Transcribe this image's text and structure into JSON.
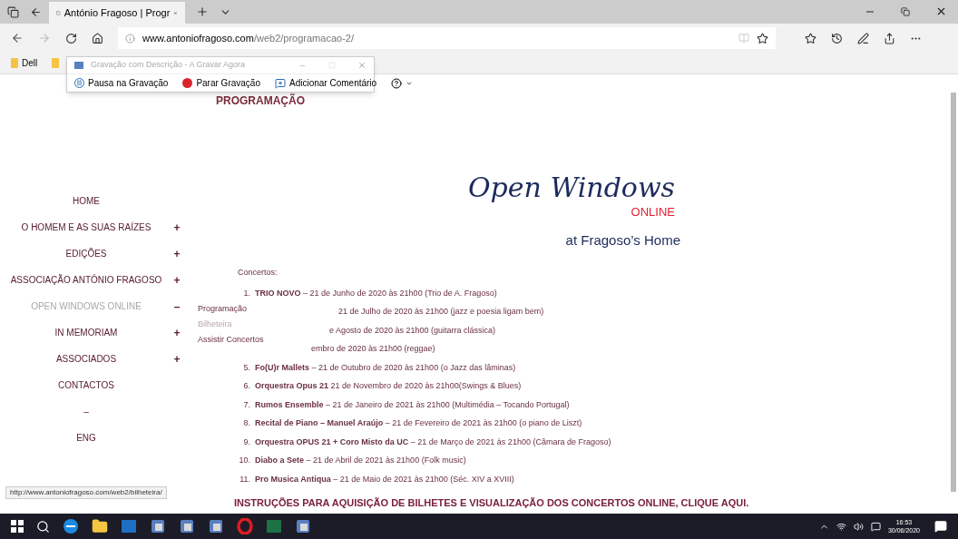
{
  "browser": {
    "tab_title": "António Fragoso | Progr",
    "url_host": "www.antoniofragoso.com",
    "url_path": "/web2/programacao-2/",
    "bookmarks": [
      "Dell"
    ]
  },
  "recorder": {
    "title": "Gravação com Descrição - A Gravar Agora",
    "buttons": [
      {
        "kind": "pause",
        "label": "Pausa na Gravação"
      },
      {
        "kind": "stop",
        "label": "Parar Gravação"
      },
      {
        "kind": "comment",
        "label": "Adicionar Comentário"
      },
      {
        "kind": "help"
      }
    ]
  },
  "page_heading": "PROGRAMAÇÃO",
  "nav": [
    {
      "label": "HOME",
      "selected": false
    },
    {
      "label": "O HOMEM E AS SUAS RAÍZES",
      "toggle": "+",
      "selected": false
    },
    {
      "label": "EDIÇÕES",
      "toggle": "+",
      "selected": false
    },
    {
      "label": "ASSOCIAÇÃO ANTÓNIO FRAGOSO",
      "toggle": "+",
      "selected": false
    },
    {
      "label": "OPEN WINDOWS ONLINE",
      "toggle": "–",
      "selected": true
    },
    {
      "label": "IN MEMORIAM",
      "toggle": "+",
      "selected": false
    },
    {
      "label": "ASSOCIADOS",
      "toggle": "+",
      "selected": false
    },
    {
      "label": "CONTACTOS",
      "selected": false
    },
    {
      "label": "–",
      "selected": false
    },
    {
      "label": "ENG",
      "selected": false
    }
  ],
  "submenu": [
    {
      "label": "Programação",
      "selected": false
    },
    {
      "label": "Bilheteira",
      "selected": true
    },
    {
      "label": "Assistir Concertos",
      "selected": false
    }
  ],
  "logo": {
    "title": "Open Windows",
    "subtitle": "ONLINE",
    "tagline": "at Fragoso’s Home"
  },
  "concerts_label": "Concertos:",
  "concerts": [
    {
      "number": "1.",
      "text": "**TRIO NOVO** – 21 de Junho de 2020 às 21h00 (Trio de A. Fragoso)"
    },
    {
      "text": "21 de Julho de 2020 às 21h00 (jazz e poesia ligam bem)"
    },
    {
      "text": "e Agosto de 2020 às 21h00 (guitarra clássica)"
    },
    {
      "text": "embro de 2020 às 21h00 (reggae)"
    },
    {
      "number": "5.",
      "text": "**Fo(U)r Mallets** – 21 de Outubro de 2020 às 21h00 (o Jazz das lâminas)"
    },
    {
      "number": "6.",
      "text": "**Orquestra Opus 21** 21 de Novembro de 2020 às 21h00(Swings & Blues)"
    },
    {
      "number": "7.",
      "text": "**Rumos Ensemble** – 21 de Janeiro de 2021 às 21h00 (Multimédia – Tocando Portugal)"
    },
    {
      "number": "8.",
      "text": "**Recital de Piano – Manuel Araújo** – 21 de Fevereiro de 2021 às 21h00 (o piano de Liszt)"
    },
    {
      "number": "9.",
      "text": "**Orquestra OPUS 21 + Coro Misto da UC** – 21 de Março de 2021 às 21h00 (Câmara de Fragoso)"
    },
    {
      "number": "10.",
      "text": "**Diabo a Sete** – 21 de Abril de 2021 às 21h00 (Folk music)"
    },
    {
      "number": "11.",
      "text": "**Pro Musica Antiqua** – 21 de Maio de 2021 às 21h00 (Séc. XIV a XVIII)"
    }
  ],
  "instructions_link": "INSTRUÇÕES PARA AQUISIÇÃO DE BILHETES E VISUALIZAÇÃO DOS CONCERTOS ONLINE, CLIQUE AQUI.",
  "status_url": "http://www.antoniofragoso.com/web2/bilheteira/",
  "taskbar": {
    "time": "16:53",
    "date": "30/06/2020"
  }
}
